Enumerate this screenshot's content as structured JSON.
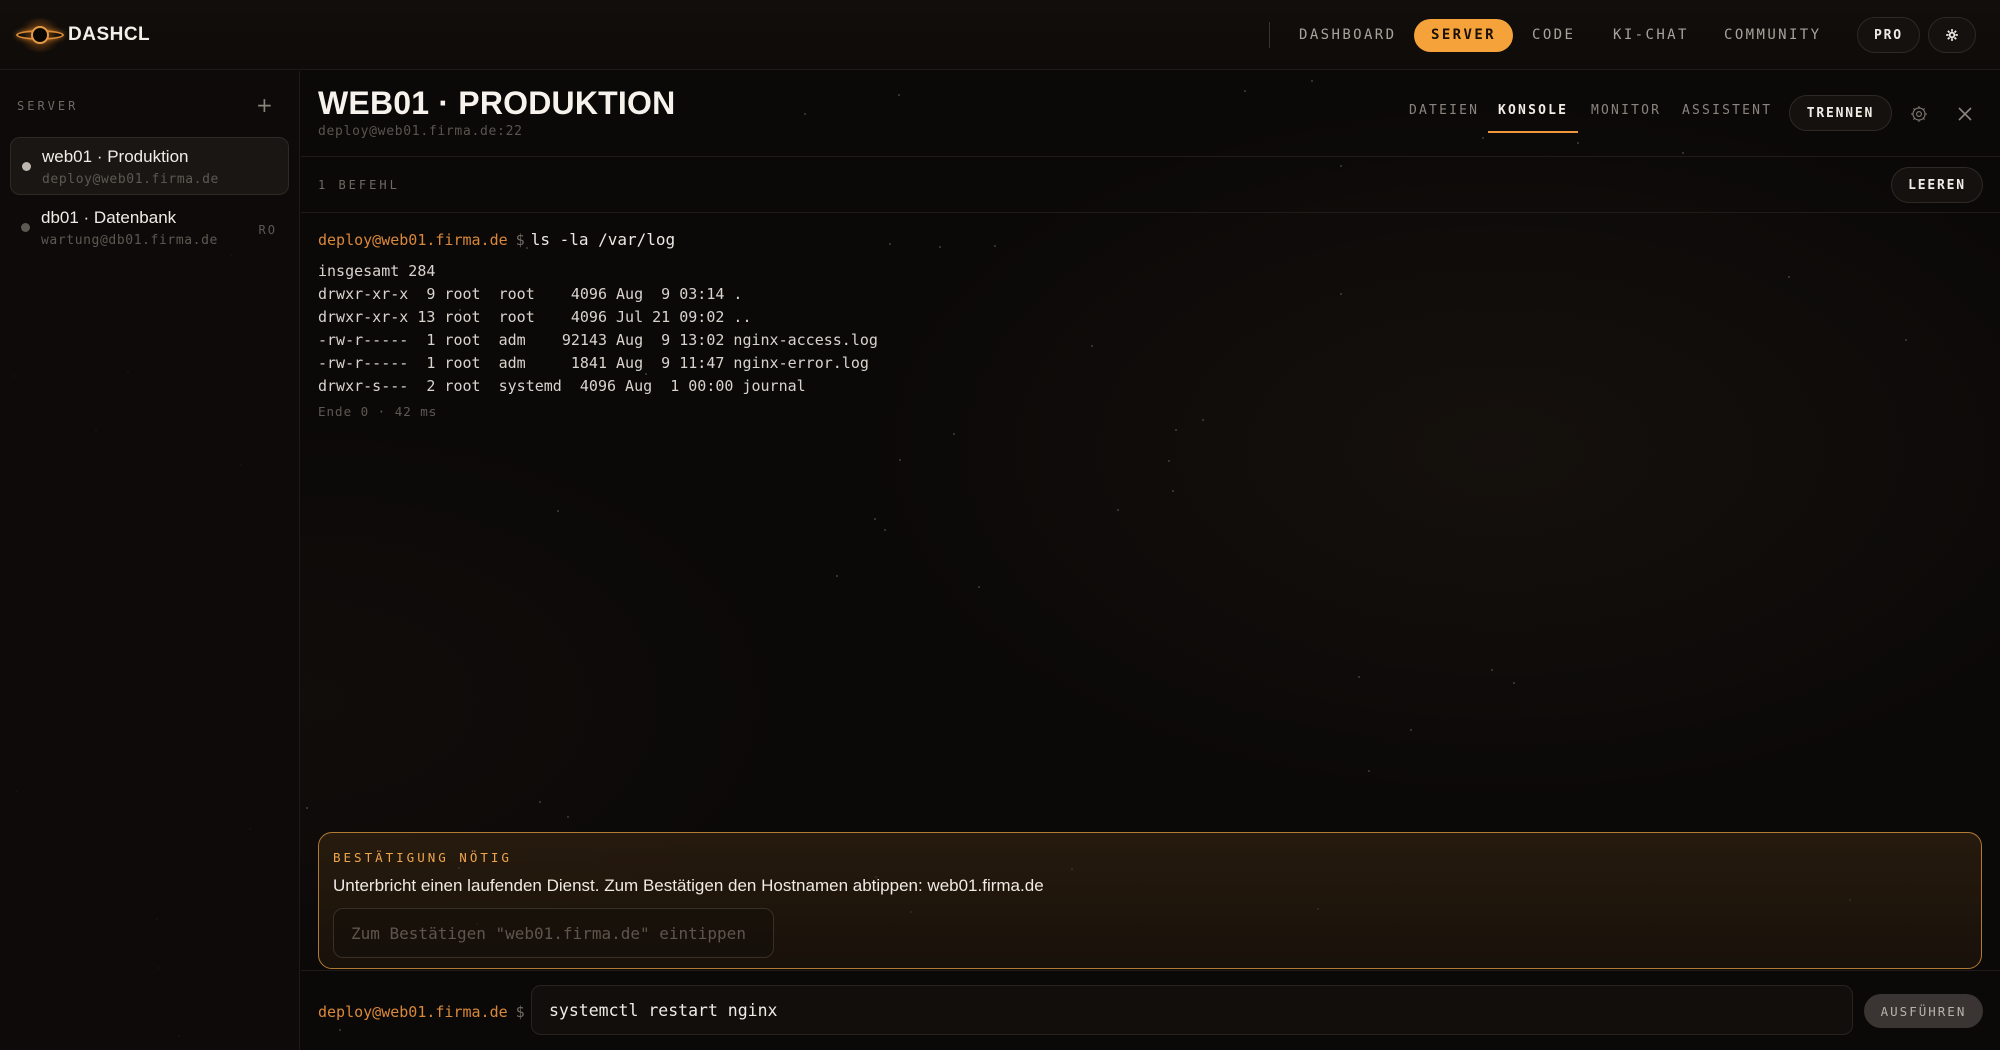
{
  "app": {
    "name": "DASHCL"
  },
  "nav": {
    "items": [
      {
        "label": "DASHBOARD",
        "active": false
      },
      {
        "label": "SERVER",
        "active": true
      },
      {
        "label": "CODE",
        "active": false
      },
      {
        "label": "KI-CHAT",
        "active": false
      },
      {
        "label": "COMMUNITY",
        "active": false
      }
    ],
    "pro_label": "PRO",
    "settings_icon": "gear-icon"
  },
  "sidebar": {
    "heading": "SERVER",
    "add_label": "+",
    "servers": [
      {
        "name": "web01 · Produktion",
        "address": "deploy@web01.firma.de",
        "badge": "",
        "active": true
      },
      {
        "name": "db01 · Datenbank",
        "address": "wartung@db01.firma.de",
        "badge": "RO",
        "active": false
      }
    ]
  },
  "header": {
    "title": "WEB01 · PRODUKTION",
    "subtitle": "deploy@web01.firma.de:22",
    "tabs": [
      {
        "label": "DATEIEN",
        "active": false
      },
      {
        "label": "KONSOLE",
        "active": true
      },
      {
        "label": "MONITOR",
        "active": false
      },
      {
        "label": "ASSISTENT",
        "active": false
      }
    ],
    "disconnect_label": "TRENNEN"
  },
  "subbar": {
    "count_label": "1 BEFEHL",
    "clear_label": "LEEREN"
  },
  "console": {
    "prompt_host": "deploy@web01.firma.de",
    "prompt_symbol": "$",
    "command": "ls -la /var/log",
    "output": [
      "insgesamt 284",
      "drwxr-xr-x  9 root  root    4096 Aug  9 03:14 .",
      "drwxr-xr-x 13 root  root    4096 Jul 21 09:02 ..",
      "-rw-r-----  1 root  adm    92143 Aug  9 13:02 nginx-access.log",
      "-rw-r-----  1 root  adm     1841 Aug  9 11:47 nginx-error.log",
      "drwxr-s---  2 root  systemd  4096 Aug  1 00:00 journal"
    ],
    "exit_info": "Ende 0 · 42 ms"
  },
  "confirm": {
    "title": "BESTÄTIGUNG NÖTIG",
    "message": "Unterbricht einen laufenden Dienst. Zum Bestätigen den Hostnamen abtippen: web01.firma.de",
    "input_value": "",
    "input_placeholder": "Zum Bestätigen \"web01.firma.de\" eintippen"
  },
  "input_bar": {
    "prompt_host": "deploy@web01.firma.de",
    "prompt_symbol": "$",
    "command_value": "systemctl restart nginx",
    "run_label": "AUSFÜHREN"
  },
  "colors": {
    "accent": "#f6a23a",
    "prompt": "#d9883a",
    "warning_border": "#b27a35",
    "background": "#0b0908"
  }
}
